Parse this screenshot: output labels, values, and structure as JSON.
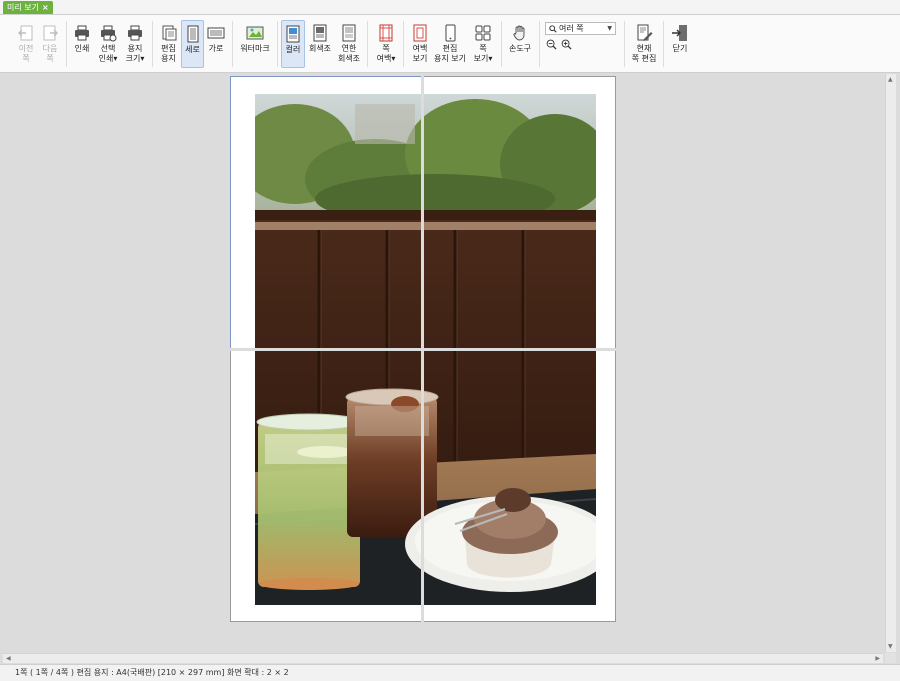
{
  "tab": {
    "label": "미리 보기",
    "close": "×"
  },
  "toolbar": {
    "prev": {
      "line1": "이전",
      "line2": "쪽"
    },
    "next": {
      "line1": "다음",
      "line2": "쪽"
    },
    "print": {
      "line1": "인쇄"
    },
    "select_print": {
      "line1": "선택",
      "line2": "인쇄▾"
    },
    "paper_size": {
      "line1": "용지",
      "line2": "크기▾"
    },
    "edit_paper": {
      "line1": "편집",
      "line2": "용지"
    },
    "portrait": {
      "line1": "세로"
    },
    "landscape": {
      "line1": "가로"
    },
    "watermark": {
      "line1": "워터마크"
    },
    "color": {
      "line1": "컬러"
    },
    "grayscale": {
      "line1": "회색조"
    },
    "light_grayscale": {
      "line1": "연한",
      "line2": "회색조"
    },
    "page_margin": {
      "line1": "쪽",
      "line2": "여백▾"
    },
    "margin_view": {
      "line1": "여백",
      "line2": "보기"
    },
    "edit_paper_view": {
      "line1": "편집",
      "line2": "용지 보기"
    },
    "page_view": {
      "line1": "쪽",
      "line2": "보기▾"
    },
    "hand_tool": {
      "line1": "손도구"
    },
    "current_page_edit": {
      "line1": "현재",
      "line2": "쪽 편집"
    },
    "close": {
      "line1": "닫기"
    }
  },
  "zoom": {
    "selected": "여러 쪽"
  },
  "status": {
    "text": "1쪽 ( 1쪽 / 4쪽 ) 편집 용지 : A4(국배판) [210 × 297 mm] 화면 확대 : 2 × 2"
  },
  "colors": {
    "tab_bg": "#6cb33e",
    "active_bg": "#dbe6f6",
    "page_border": "#7c95c4",
    "viewport_bg": "#dcdcdc"
  }
}
